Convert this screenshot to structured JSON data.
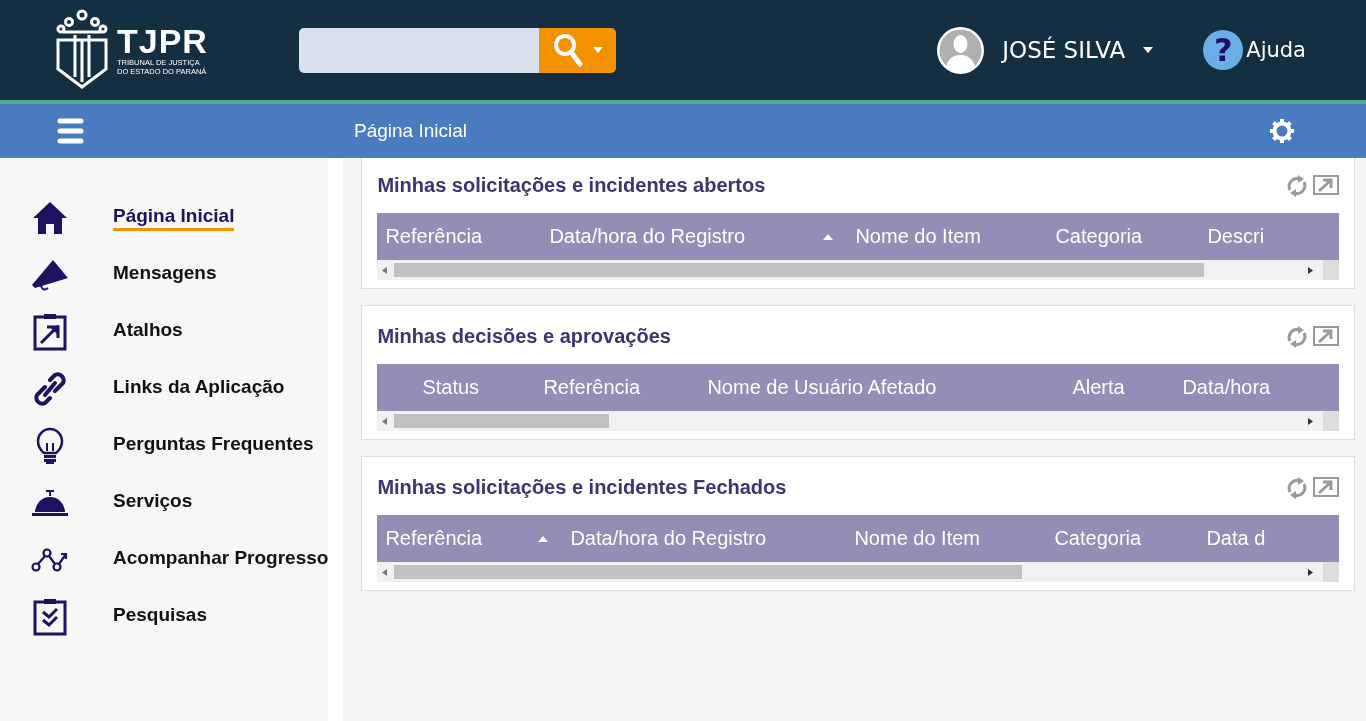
{
  "header": {
    "logo": {
      "name": "TJPR",
      "subtitle_1": "TRIBUNAL DE JUSTIÇA",
      "subtitle_2": "DO ESTADO DO PARANÁ"
    },
    "user": {
      "name": "JOSÉ SILVA"
    },
    "help": {
      "glyph": "?",
      "label": "Ajuda"
    }
  },
  "nav_bar": {
    "title": "Página Inicial"
  },
  "sidebar": {
    "items": [
      {
        "kind": "home",
        "label": "Página Inicial",
        "selected": true
      },
      {
        "kind": "megaphone",
        "label": "Mensagens",
        "selected": false
      },
      {
        "kind": "shortcut",
        "label": "Atalhos",
        "selected": false
      },
      {
        "kind": "link",
        "label": "Links da Aplicação",
        "selected": false
      },
      {
        "kind": "bulb",
        "label": "Perguntas Frequentes",
        "selected": false
      },
      {
        "kind": "bell",
        "label": "Serviços",
        "selected": false
      },
      {
        "kind": "progress",
        "label": "Acompanhar Progresso",
        "selected": false
      },
      {
        "kind": "survey",
        "label": "Pesquisas",
        "selected": false
      }
    ]
  },
  "panels": [
    {
      "title": "Minhas solicitações e incidentes abertos",
      "columns": [
        {
          "label": "Referência",
          "sorted": false
        },
        {
          "label": "Data/hora do Registro",
          "sorted": true
        },
        {
          "label": "Nome do Item",
          "sorted": false
        },
        {
          "label": "Categoria",
          "sorted": false
        },
        {
          "label": "Descri",
          "sorted": false
        }
      ]
    },
    {
      "title": "Minhas decisões e aprovações",
      "columns": [
        {
          "label": "Status",
          "sorted": false
        },
        {
          "label": "Referência",
          "sorted": false
        },
        {
          "label": "Nome de Usuário Afetado",
          "sorted": false
        },
        {
          "label": "Alerta",
          "sorted": false
        },
        {
          "label": "Data/hora",
          "sorted": false
        }
      ]
    },
    {
      "title": "Minhas solicitações e incidentes Fechados",
      "columns": [
        {
          "label": "Referência",
          "sorted": true
        },
        {
          "label": "Data/hora do Registro",
          "sorted": false
        },
        {
          "label": "Nome do Item",
          "sorted": false
        },
        {
          "label": "Categoria",
          "sorted": false
        },
        {
          "label": "Data d",
          "sorted": false
        }
      ]
    }
  ]
}
